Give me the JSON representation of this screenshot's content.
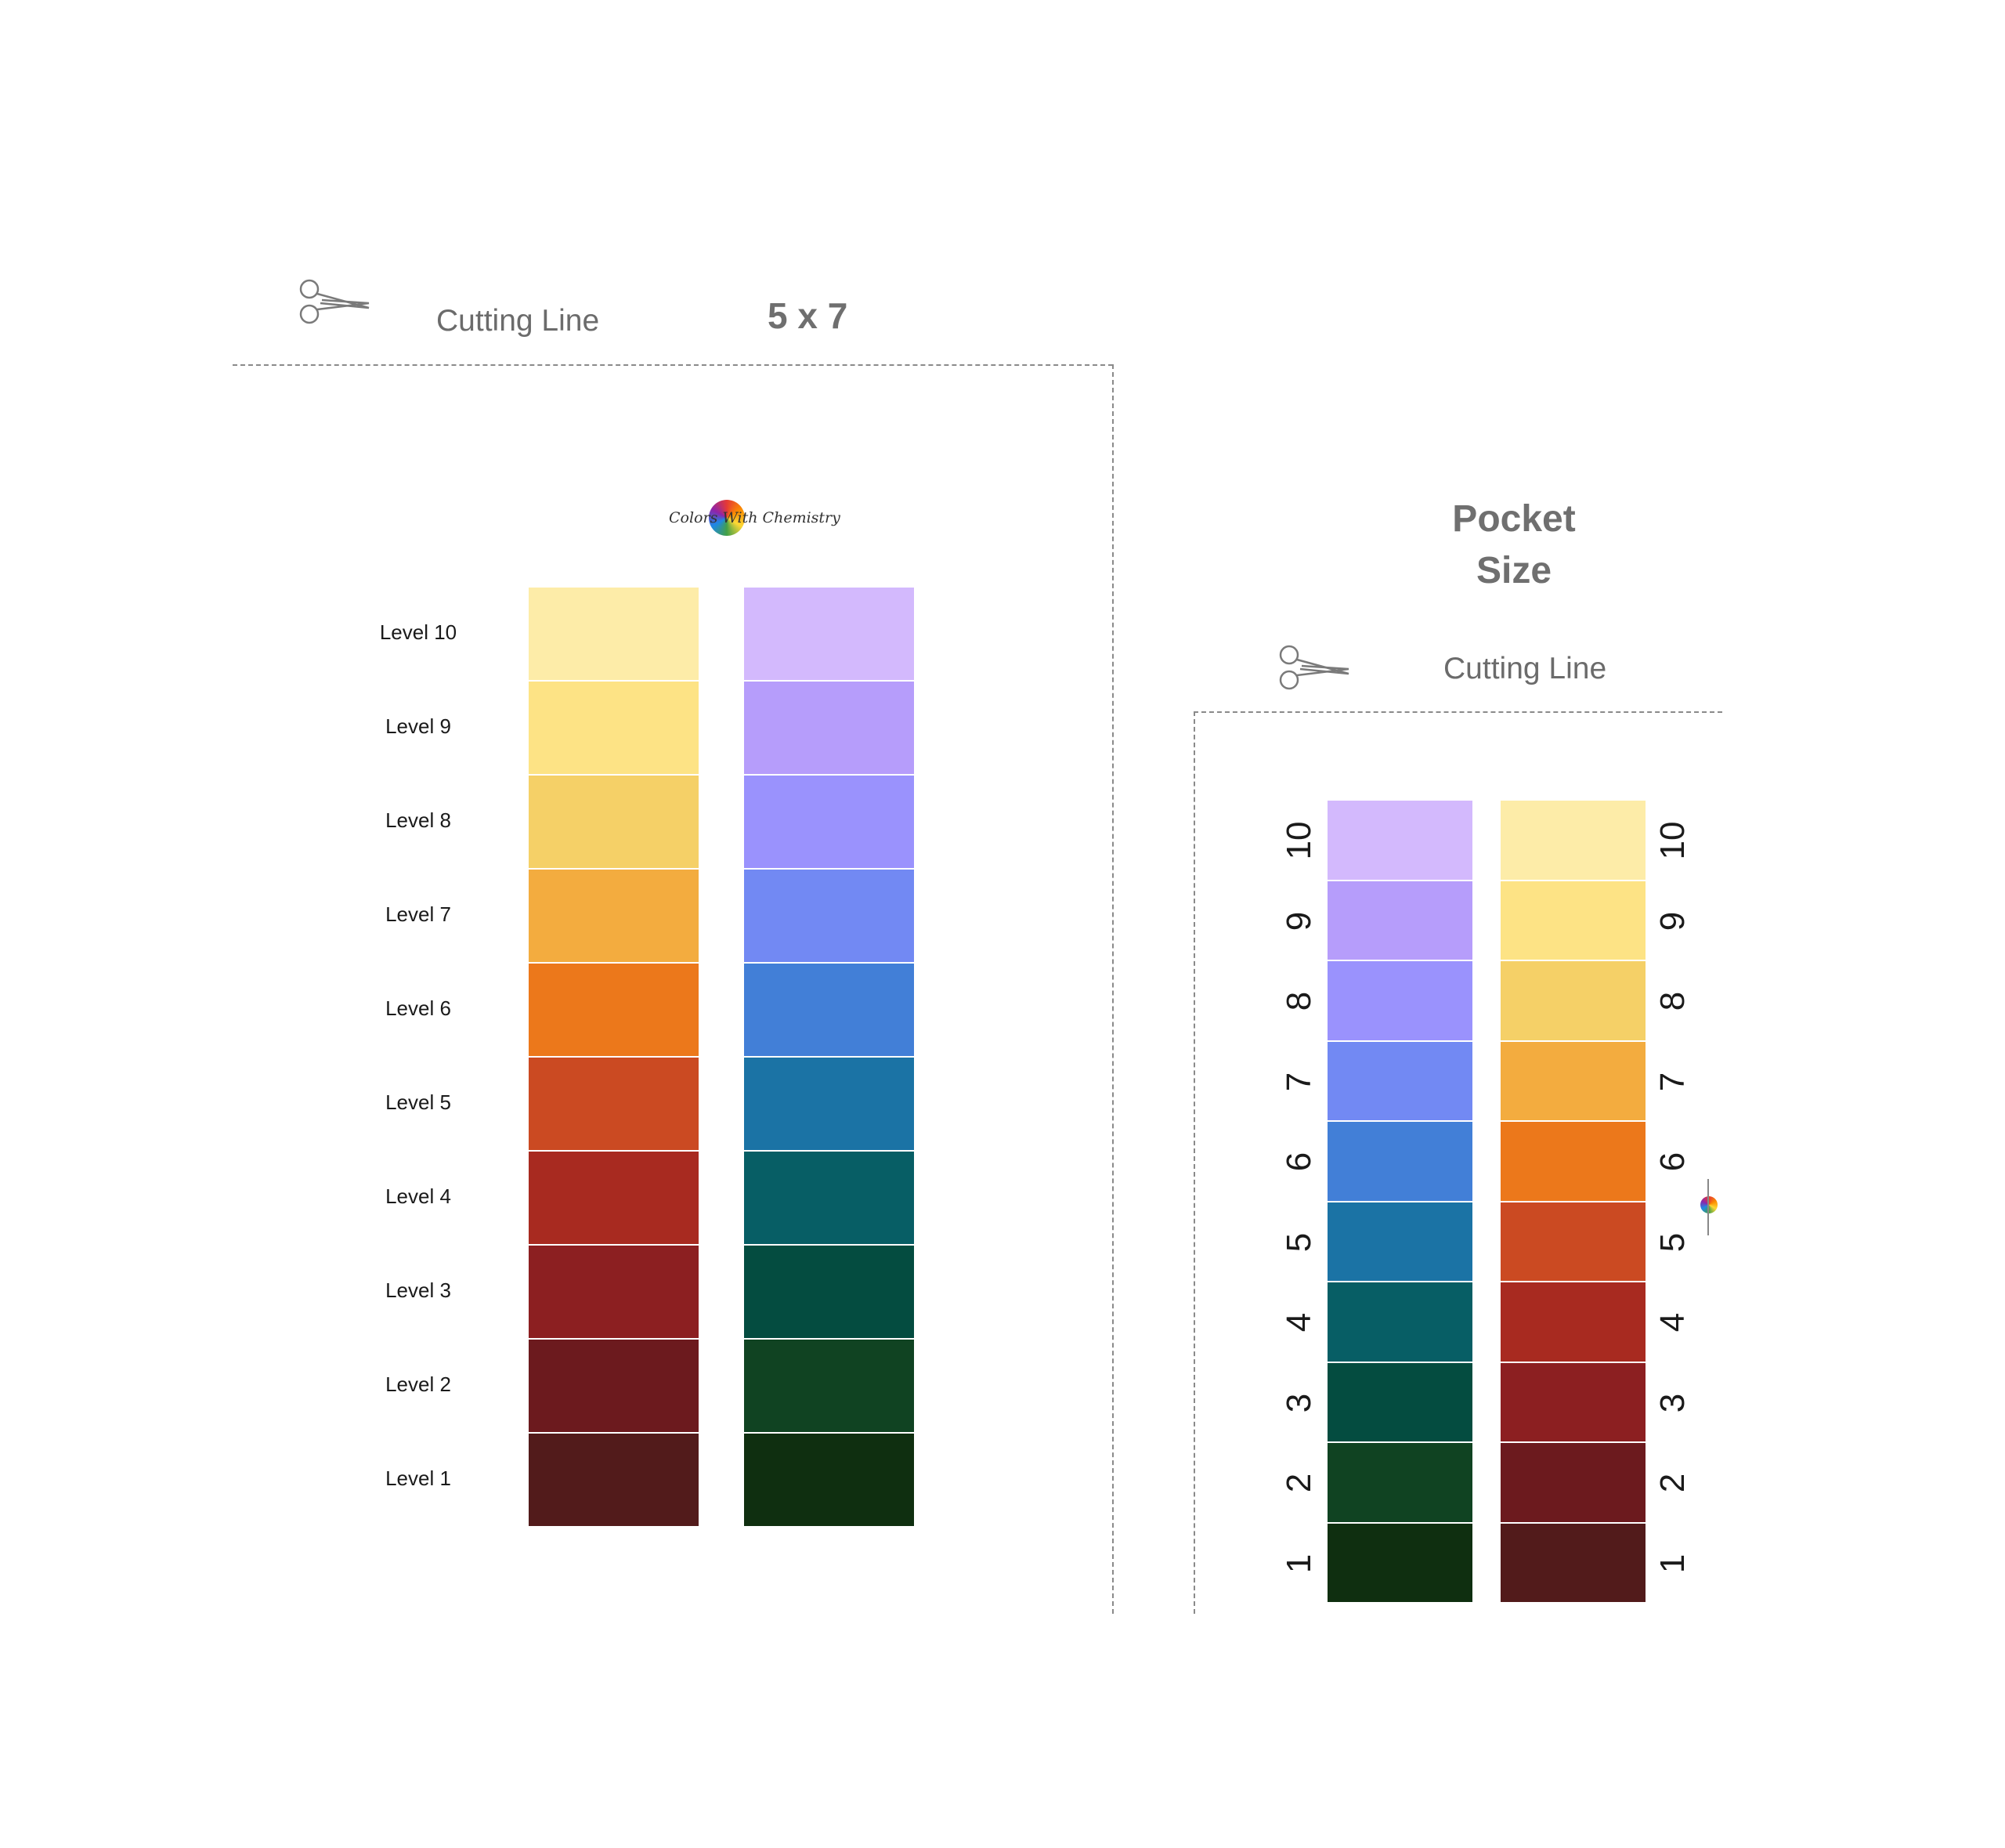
{
  "five_by_seven": {
    "cutting_label": "Cutting Line",
    "size_title": "5 x 7",
    "logo_text": "Colors With Chemistry",
    "levels": [
      "Level 10",
      "Level 9",
      "Level 8",
      "Level 7",
      "Level 6",
      "Level 5",
      "Level 4",
      "Level 3",
      "Level 2",
      "Level 1"
    ],
    "warm_colors": [
      "#fdeca8",
      "#fde385",
      "#f5d067",
      "#f3ac3f",
      "#ec781b",
      "#cb4a22",
      "#a82a20",
      "#8c1f21",
      "#6c1a1e",
      "#521b1b"
    ],
    "cool_colors": [
      "#d3b9fd",
      "#b69dfb",
      "#9a92fd",
      "#7289f3",
      "#427fd7",
      "#1b73a5",
      "#075e65",
      "#044c40",
      "#104322",
      "#0f2f10"
    ]
  },
  "pocket": {
    "title_line1": "Pocket",
    "title_line2": "Size",
    "cutting_label": "Cutting Line",
    "numbers": [
      "10",
      "9",
      "8",
      "7",
      "6",
      "5",
      "4",
      "3",
      "2",
      "1"
    ],
    "cool_colors": [
      "#d3b9fd",
      "#b69dfb",
      "#9a92fd",
      "#7289f3",
      "#427fd7",
      "#1b73a5",
      "#075e65",
      "#044c40",
      "#104322",
      "#0f2f10"
    ],
    "warm_colors": [
      "#fdeca8",
      "#fde385",
      "#f5d067",
      "#f3ac3f",
      "#ec781b",
      "#cb4a22",
      "#a82a20",
      "#8c1f21",
      "#6c1a1e",
      "#521b1b"
    ]
  },
  "icons": {
    "scissors": "scissors-icon",
    "logo": "colors-with-chemistry-logo"
  }
}
